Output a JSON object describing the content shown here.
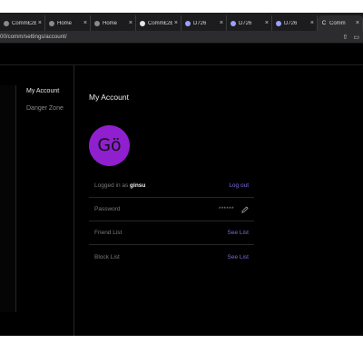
{
  "browser": {
    "tabs": [
      {
        "title": "Comm£2£",
        "favicon": "page"
      },
      {
        "title": "Home",
        "favicon": "page"
      },
      {
        "title": "Home",
        "favicon": "page"
      },
      {
        "title": "Comm£2£",
        "favicon": "github"
      },
      {
        "title": "D726",
        "favicon": "dot"
      },
      {
        "title": "D726",
        "favicon": "dot"
      },
      {
        "title": "D726",
        "favicon": "dot"
      },
      {
        "title": "Comm",
        "favicon": "c"
      }
    ],
    "close_glyph": "×",
    "url": "00/comm/settings/account/",
    "share_icon": "share-icon",
    "reader_icon": "sidebar-icon"
  },
  "subnav": {
    "items": [
      {
        "label": "My Account",
        "active": true
      },
      {
        "label": "Danger Zone",
        "active": false
      }
    ]
  },
  "account": {
    "title": "My Account",
    "avatar": {
      "initials": "Gö",
      "color": "#8f1fcf"
    },
    "logged_in": {
      "prefix": "Logged in as",
      "username": "ginsu",
      "action": "Log out"
    },
    "password": {
      "label": "Password",
      "masked": "******",
      "edit_icon": "pencil-icon"
    },
    "friend_list": {
      "label": "Friend List",
      "action": "See List"
    },
    "block_list": {
      "label": "Block List",
      "action": "See List"
    }
  },
  "colors": {
    "accent": "#7b6bdc",
    "background": "#000000",
    "avatar": "#8f1fcf"
  }
}
